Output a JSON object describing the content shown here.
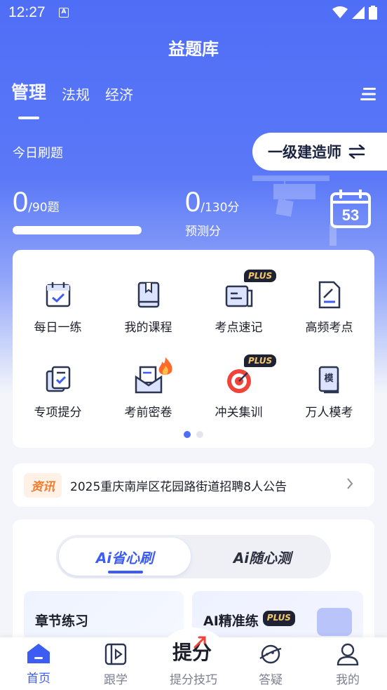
{
  "status_bar": {
    "time": "12:27",
    "a_icon": "A"
  },
  "header": {
    "title": "益题库",
    "tabs": [
      {
        "label": "管理",
        "active": true
      },
      {
        "label": "法规",
        "active": false
      },
      {
        "label": "经济",
        "active": false
      }
    ]
  },
  "today": {
    "label": "今日刷题",
    "exam_level": "一级建造师",
    "done_count": "0",
    "done_total": "/90题",
    "progress": 0,
    "predicted_score": "0",
    "predicted_total": "/130分",
    "predicted_label": "预测分",
    "calendar_day": "53"
  },
  "tools": {
    "items": [
      {
        "label": "每日一练",
        "icon": "calendar-check-icon"
      },
      {
        "label": "我的课程",
        "icon": "book-icon"
      },
      {
        "label": "考点速记",
        "icon": "notes-icon",
        "badge": "PLUS"
      },
      {
        "label": "高频考点",
        "icon": "edit-doc-icon"
      },
      {
        "label": "专项提分",
        "icon": "checklist-icon"
      },
      {
        "label": "考前密卷",
        "icon": "envelope-icon",
        "hot": true
      },
      {
        "label": "冲关集训",
        "icon": "target-icon",
        "badge": "PLUS"
      },
      {
        "label": "万人模考",
        "icon": "mock-exam-icon"
      }
    ],
    "page_index": 0,
    "page_count": 2
  },
  "news": {
    "tag": "资讯",
    "text": "2025重庆南岸区花园路街道招聘8人公告"
  },
  "ai_panel": {
    "tab_active": "Ai省心刷",
    "tab_other": "Ai随心测",
    "card_left": "章节练习",
    "card_right": "AI精准练",
    "card_right_badge": "PLUS"
  },
  "bottom_nav": {
    "items": [
      {
        "label": "首页",
        "active": true
      },
      {
        "label": "跟学"
      },
      {
        "label": "提分技巧",
        "logo": "提分"
      },
      {
        "label": "答疑"
      },
      {
        "label": "我的"
      }
    ]
  },
  "colors": {
    "primary": "#4f6ef6",
    "accent": "#3d5cf2",
    "plus_bg": "#1f2233",
    "plus_text": "#f6c86a",
    "news_tag": "#f07b2b"
  }
}
